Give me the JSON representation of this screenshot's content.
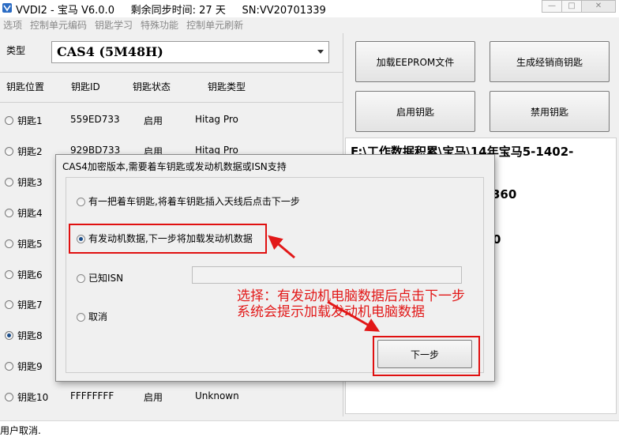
{
  "window": {
    "title": "VVDI2 - 宝马 V6.0.0",
    "sync_time": "剩余同步时间: 27 天",
    "serial": "SN:VV20701339"
  },
  "menu": [
    "选项",
    "控制单元编码",
    "钥匙学习",
    "特殊功能",
    "控制单元刷新"
  ],
  "type_selector": {
    "label": "类型",
    "value": "CAS4 (5M48H)"
  },
  "key_table": {
    "headers": [
      "钥匙位置",
      "钥匙ID",
      "钥匙状态",
      "钥匙类型"
    ],
    "rows": [
      {
        "pos": "钥匙1",
        "id": "559ED733",
        "status": "启用",
        "type": "Hitag Pro"
      },
      {
        "pos": "钥匙2",
        "id": "929BD733",
        "status": "启用",
        "type": "Hitag Pro"
      },
      {
        "pos": "钥匙3",
        "id": "",
        "status": "",
        "type": ""
      },
      {
        "pos": "钥匙4",
        "id": "",
        "status": "",
        "type": ""
      },
      {
        "pos": "钥匙5",
        "id": "",
        "status": "",
        "type": ""
      },
      {
        "pos": "钥匙6",
        "id": "",
        "status": "",
        "type": ""
      },
      {
        "pos": "钥匙7",
        "id": "",
        "status": "",
        "type": ""
      },
      {
        "pos": "钥匙8",
        "id": "",
        "status": "",
        "type": ""
      },
      {
        "pos": "钥匙9",
        "id": "",
        "status": "",
        "type": ""
      },
      {
        "pos": "钥匙10",
        "id": "FFFFFFFF",
        "status": "启用",
        "type": "Unknown"
      }
    ],
    "selected_row": 7
  },
  "buttons": {
    "load_eeprom": "加载EEPROM文件",
    "gen_dealer_key": "生成经销商钥匙",
    "enable_key": "启用钥匙",
    "disable_key": "禁用钥匙"
  },
  "info": {
    "line1": "F:\\工作数据积累\\宝马\\14年宝马5-1402-",
    "fragment_a": "360",
    "fragment_b": "0"
  },
  "dialog": {
    "title": "CAS4加密版本,需要着车钥匙或发动机数据或ISN支持",
    "options": [
      "有一把着车钥匙,将着车钥匙插入天线后点击下一步",
      "有发动机数据,下一步将加载发动机数据",
      "已知ISN",
      "取消"
    ],
    "selected_option": 1,
    "next_button": "下一步"
  },
  "annotation": {
    "line1": "选择：有发动机电脑数据后点击下一步",
    "line2": "系统会提示加载发动机电脑数据",
    "color": "#e21818"
  },
  "status_bar": "用户取消."
}
